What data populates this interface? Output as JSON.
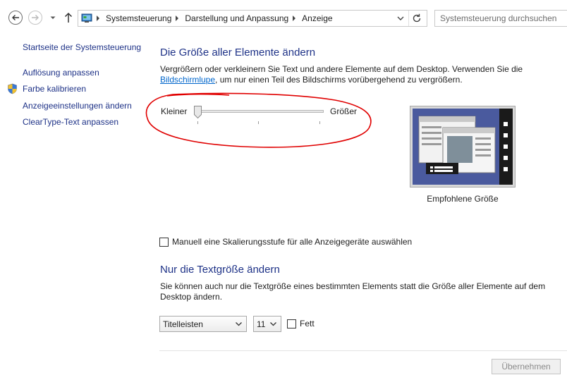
{
  "breadcrumb": [
    "Systemsteuerung",
    "Darstellung und Anpassung",
    "Anzeige"
  ],
  "search": {
    "placeholder": "Systemsteuerung durchsuchen"
  },
  "sidebar": {
    "home": "Startseite der Systemsteuerung",
    "links": [
      "Auflösung anpassen",
      "Farbe kalibrieren",
      "Anzeigeeinstellungen ändern",
      "ClearType-Text anpassen"
    ]
  },
  "size_section": {
    "title": "Die Größe aller Elemente ändern",
    "description_pre": "Vergrößern oder verkleinern Sie Text und andere Elemente auf dem Desktop. Verwenden Sie die ",
    "description_link": "Bildschirmlupe",
    "description_post": ", um nur einen Teil des Bildschirms vorübergehend zu vergrößern.",
    "slider": {
      "min_label": "Kleiner",
      "max_label": "Größer",
      "value": 0,
      "steps": 3
    },
    "preview_caption": "Empfohlene Größe"
  },
  "manual_scaling": {
    "label": "Manuell eine Skalierungsstufe für alle Anzeigegeräte auswählen",
    "checked": false
  },
  "text_section": {
    "title": "Nur die Textgröße ändern",
    "description": "Sie können auch nur die Textgröße eines bestimmten Elements statt die Größe aller Elemente auf dem Desktop ändern.",
    "element_select": "Titelleisten",
    "size_select": "11",
    "bold_label": "Fett",
    "bold_checked": false
  },
  "apply_button": "Übernehmen",
  "colors": {
    "link": "#1e3287",
    "hyperlink": "#0066cc",
    "annotation": "#e00000",
    "preview_bg": "#4a5a9e"
  }
}
